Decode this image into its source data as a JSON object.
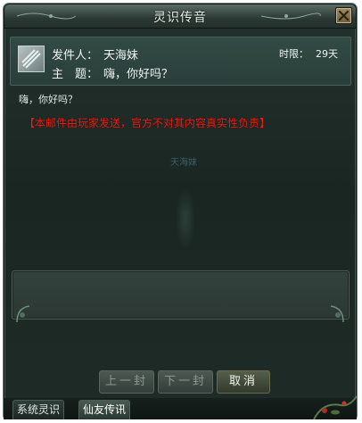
{
  "window": {
    "title": "灵识传音",
    "close_icon": "close-x-icon"
  },
  "mail": {
    "icon": "mail-scroll-icon",
    "sender_label": "发件人：",
    "sender": "天海妹",
    "subject_label": "主　题：",
    "subject": "嗨，你好吗？",
    "expire_label": "时限：",
    "expire_value": "29天",
    "body": "嗨，你好吗？",
    "notice": "【本邮件由玩家发送，官方不对其内容真实性负责】"
  },
  "background": {
    "ghost_label": "天海妹"
  },
  "buttons": {
    "prev": "上一封",
    "next": "下一封",
    "cancel": "取消"
  },
  "tabs": [
    {
      "label": "系统灵识",
      "active": false
    },
    {
      "label": "仙友传讯",
      "active": true
    }
  ],
  "colors": {
    "notice": "#e41f14",
    "panel": "#1e2b27",
    "header": "#2a3e3a"
  }
}
